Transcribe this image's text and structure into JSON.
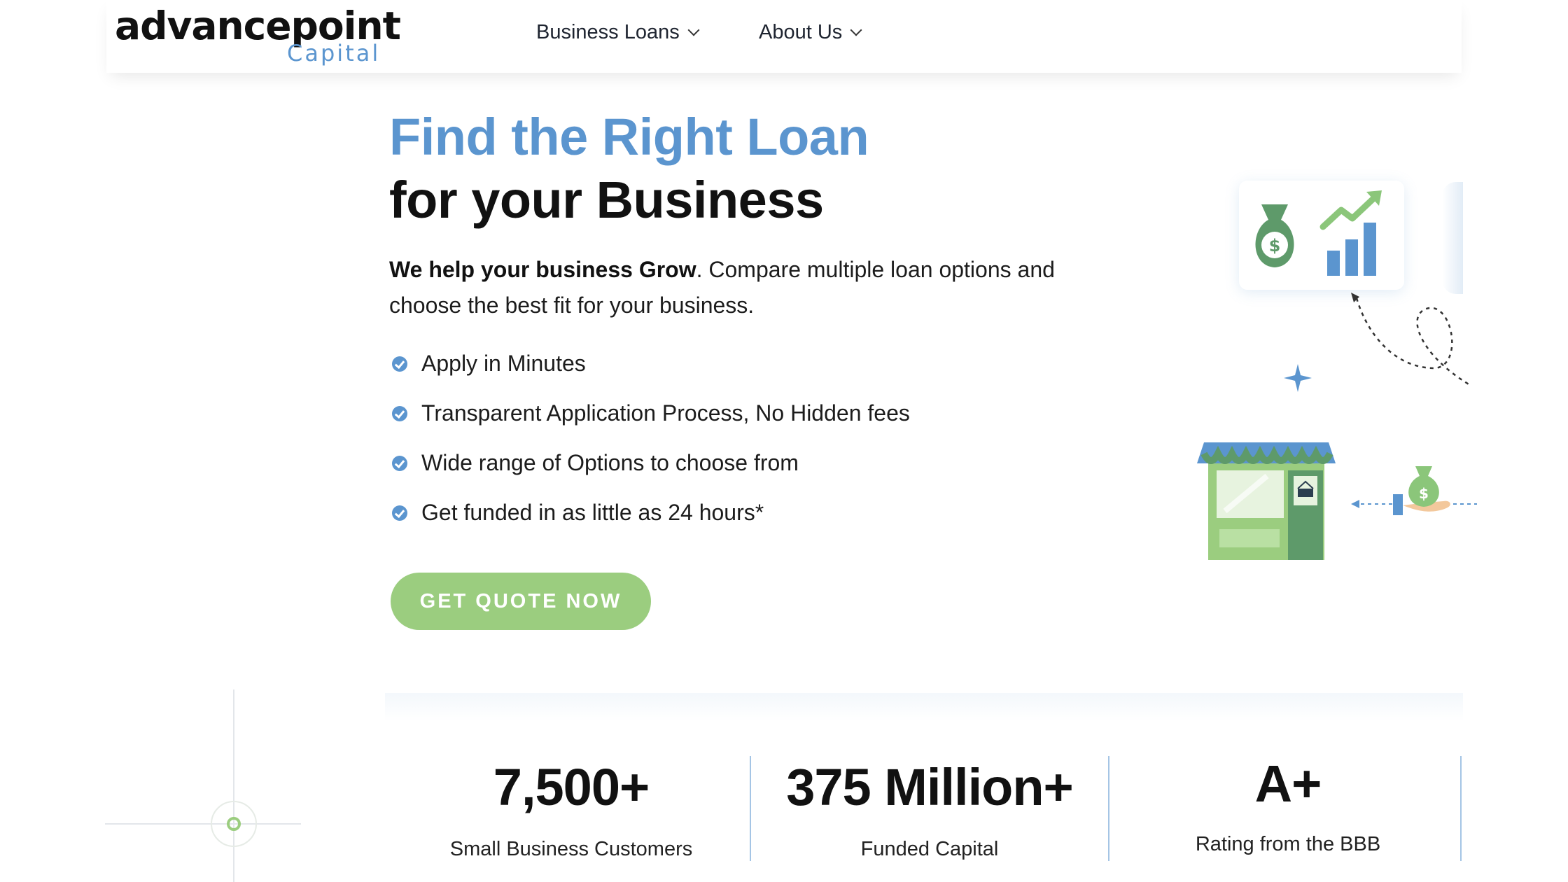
{
  "header": {
    "logo_main": "advancepoint",
    "logo_sub": "Capital",
    "nav": [
      {
        "label": "Business Loans"
      },
      {
        "label": "About Us"
      }
    ]
  },
  "hero": {
    "title_line1": "Find the Right Loan",
    "title_line2": "for your Business",
    "desc_bold": "We help your business Grow",
    "desc_rest": ". Compare multiple loan options and choose the best fit for your business.",
    "features": [
      "Apply in Minutes",
      "Transparent Application Process, No Hidden fees",
      "Wide range of Options to choose from",
      "Get funded in as little as 24 hours*"
    ],
    "cta_label": "GET QUOTE NOW"
  },
  "stats": [
    {
      "value": "7,500+",
      "label": "Small Business Customers"
    },
    {
      "value": "375 Million+",
      "label": "Funded Capital"
    },
    {
      "value": "A+",
      "label": "Rating from the BBB"
    }
  ],
  "colors": {
    "brand_blue": "#5b95cf",
    "cta_green": "#9bcd7f",
    "illustration_green": "#5e9a6a"
  },
  "icons": [
    "check-icon",
    "chevron-down-icon",
    "money-bag-icon",
    "growth-chart-icon",
    "storefront-icon",
    "hand-money-icon",
    "sparkle-icon"
  ]
}
